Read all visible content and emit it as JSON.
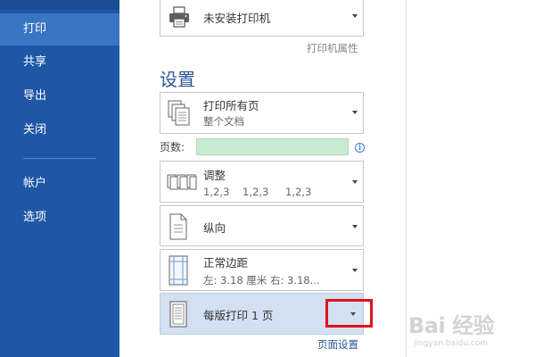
{
  "sidebar": {
    "items": [
      {
        "label": "打印",
        "active": true
      },
      {
        "label": "共享"
      },
      {
        "label": "导出"
      },
      {
        "label": "关闭"
      },
      {
        "label": "帐户"
      },
      {
        "label": "选项"
      }
    ]
  },
  "printer": {
    "name": "未安装打印机",
    "properties_link": "打印机属性",
    "icon": "printer-icon"
  },
  "settings": {
    "heading": "设置",
    "print_range": {
      "title": "打印所有页",
      "subtitle": "整个文档",
      "icon": "pages-stack-icon"
    },
    "pages_label": "页数:",
    "pages_value": "",
    "collate": {
      "title": "调整",
      "subtitle_parts": [
        "1,2,3",
        "1,2,3",
        "1,2,3"
      ],
      "icon": "collated-copies-icon"
    },
    "orientation": {
      "title": "纵向",
      "icon": "portrait-page-icon"
    },
    "margins": {
      "title": "正常边距",
      "subtitle": "左:  3.18 厘米    右:  3.18...",
      "icon": "margins-page-icon"
    },
    "per_sheet": {
      "title": "每版打印 1 页",
      "icon": "single-page-icon",
      "selected_color": "#d2e0f2"
    },
    "page_setup_link": "页面设置"
  },
  "watermark": {
    "main": "Bai 经验",
    "sub": "jingyan.baidu.com"
  },
  "colors": {
    "sidebar": "#1f57a6",
    "sidebar_active": "#3a75c4",
    "accent": "#2b5797",
    "highlight_box": "#e0121b"
  }
}
